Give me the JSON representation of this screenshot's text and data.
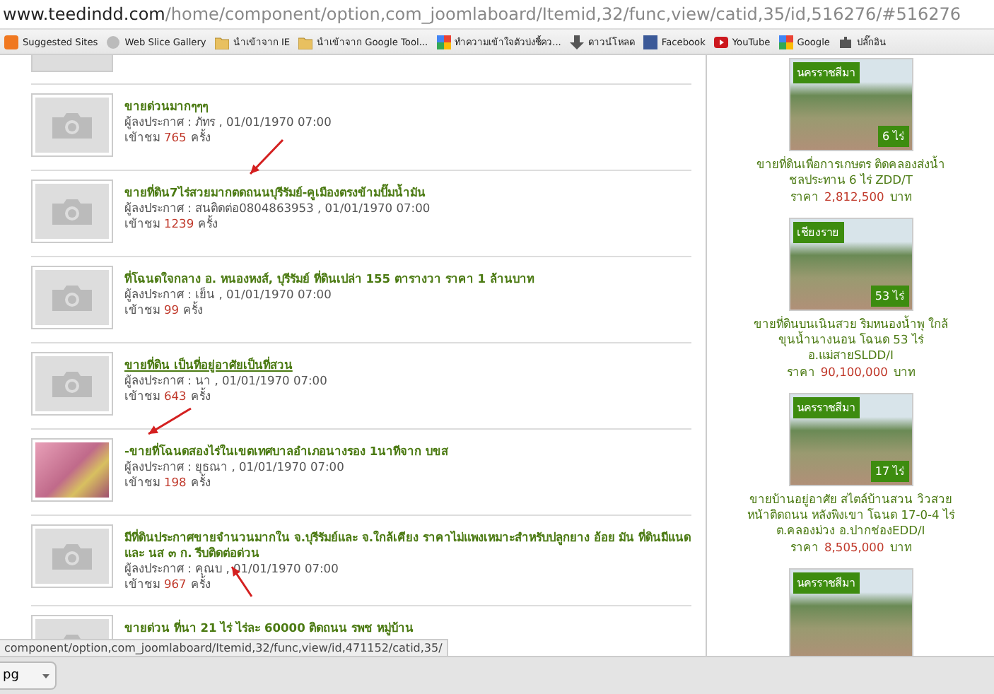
{
  "address_bar": {
    "domain": "www.teedindd.com",
    "path": "/home/component/option,com_joomlaboard/Itemid,32/func,view/catid,35/id,516276/#516276"
  },
  "bookmarks": [
    {
      "kind": "site",
      "label": "Suggested Sites"
    },
    {
      "kind": "gallery",
      "label": "Web Slice Gallery"
    },
    {
      "kind": "folder",
      "label": "นำเข้าจาก IE"
    },
    {
      "kind": "folder",
      "label": "นำเข้าจาก Google Tool..."
    },
    {
      "kind": "google",
      "label": "ทำความเข้าใจตัวบ่งชี้คว..."
    },
    {
      "kind": "download",
      "label": "ดาวน์โหลด"
    },
    {
      "kind": "facebook",
      "label": "Facebook"
    },
    {
      "kind": "youtube",
      "label": "YouTube"
    },
    {
      "kind": "google",
      "label": "Google"
    },
    {
      "kind": "plugin",
      "label": "ปลั๊กอิน"
    }
  ],
  "posts": [
    {
      "kind": "placeholder",
      "title": "ขายด่วนมากๆๆๆ",
      "hovered": false,
      "meta": "ผู้ลงประกาศ : ภัทร , 01/01/1970 07:00",
      "views_label": "เข้าชม",
      "views": "765",
      "views_unit": "ครั้ง"
    },
    {
      "kind": "placeholder",
      "title": "ขายที่ดิน7ไร่สวยมากตดถนนบุรีรัมย์-คูเมืองตรงข้ามปั๊มน้ำมัน",
      "hovered": false,
      "meta": "ผู้ลงประกาศ : สนติดต่อ0804863953 , 01/01/1970 07:00",
      "views_label": "เข้าชม",
      "views": "1239",
      "views_unit": "ครั้ง"
    },
    {
      "kind": "placeholder",
      "title": "ที่โฉนดใจกลาง อ. หนองหงส์, บุรีรัมย์ ที่ดินเปล่า 155 ตารางวา ราคา 1 ล้านบาท",
      "hovered": false,
      "meta": "ผู้ลงประกาศ : เย็น , 01/01/1970 07:00",
      "views_label": "เข้าชม",
      "views": "99",
      "views_unit": "ครั้ง"
    },
    {
      "kind": "placeholder",
      "title": "ขายที่ดิน เป็นที่อยู่อาศัยเป็นที่สวน",
      "hovered": true,
      "meta": "ผู้ลงประกาศ : นา , 01/01/1970 07:00",
      "views_label": "เข้าชม",
      "views": "643",
      "views_unit": "ครั้ง"
    },
    {
      "kind": "photo",
      "title": "-ขายที่โฉนดสองไร่ในเขตเทศบาลอำเภอนางรอง 1นาทีจาก บขส",
      "hovered": false,
      "meta": "ผู้ลงประกาศ : ยุธณา , 01/01/1970 07:00",
      "views_label": "เข้าชม",
      "views": "198",
      "views_unit": "ครั้ง"
    },
    {
      "kind": "placeholder",
      "title": "มีที่ดินประกาศขายจำนวนมากใน จ.บุรีรัมย์และ จ.ใกล้เคียง ราคาไม่แพงเหมาะสำหรับปลูกยาง อ้อย มัน ที่ดินมีแนด และ นส ๓ ก. รีบติดต่อด่วน",
      "hovered": false,
      "meta": "ผู้ลงประกาศ : คุณบ , 01/01/1970 07:00",
      "views_label": "เข้าชม",
      "views": "967",
      "views_unit": "ครั้ง"
    },
    {
      "kind": "placeholder",
      "title": "ขายด่วน ที่นา 21 ไร่ ไร่ละ 60000 ติดถนน รพช หมู่บ้าน",
      "hovered": false
    }
  ],
  "listings": [
    {
      "region": "นครราชสีมา",
      "size": "6 ไร่",
      "title_lines": [
        "ขายที่ดินเพื่อการเกษตร ติดคลองส่งน้ำ",
        "ชลประทาน 6 ไร่ ZDD/T"
      ],
      "price_label": "ราคา",
      "price": "2,812,500",
      "currency": "บาท"
    },
    {
      "region": "เชียงราย",
      "size": "53 ไร่",
      "title_lines": [
        "ขายที่ดินบนเนินสวย ริมหนองน้ำพุ ใกล้",
        "ขุนน้ำนางนอน โฉนด 53 ไร่",
        "อ.แม่สายSLDD/I"
      ],
      "price_label": "ราคา",
      "price": "90,100,000",
      "currency": "บาท"
    },
    {
      "region": "นครราชสีมา",
      "size": "17 ไร่",
      "title_lines": [
        "ขายบ้านอยู่อาศัย สไตล์บ้านสวน วิวสวย",
        "หน้าติดถนน หลังพิงเขา โฉนด 17-0-4 ไร่",
        "ต.คลองม่วง อ.ปากช่องEDD/I"
      ],
      "price_label": "ราคา",
      "price": "8,505,000",
      "currency": "บาท"
    },
    {
      "region": "นครราชสีมา"
    }
  ],
  "status_url": "component/option,com_joomlaboard/Itemid,32/func,view/id,471152/catid,35/",
  "download": {
    "file": "pg"
  }
}
